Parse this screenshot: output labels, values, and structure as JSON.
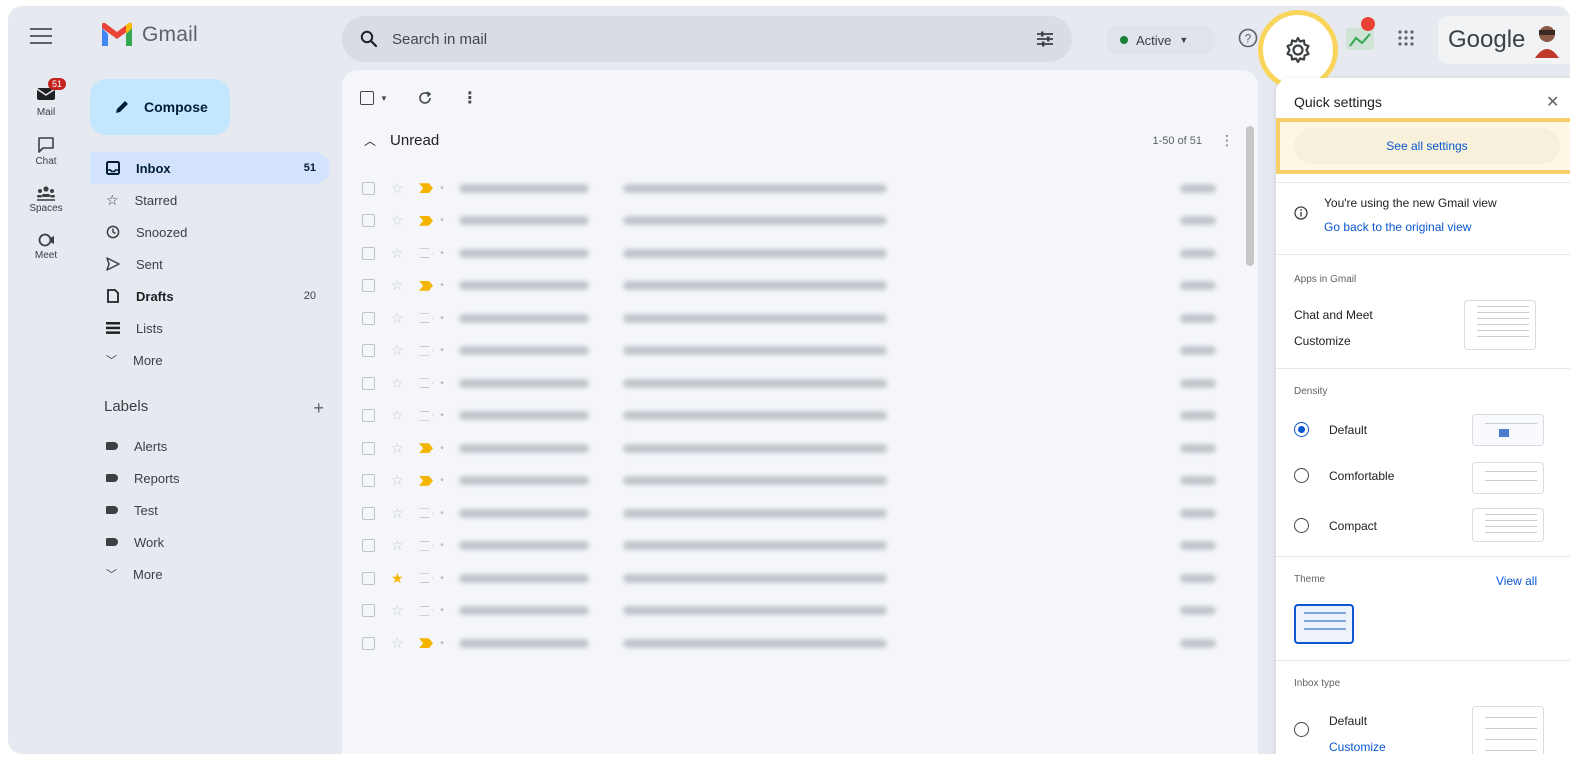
{
  "app": {
    "brand": "Gmail",
    "account_brand": "Google"
  },
  "search": {
    "placeholder": "Search in mail"
  },
  "status": {
    "label": "Active"
  },
  "rail": {
    "mail": {
      "label": "Mail",
      "badge": "51"
    },
    "chat": {
      "label": "Chat"
    },
    "spaces": {
      "label": "Spaces"
    },
    "meet": {
      "label": "Meet"
    }
  },
  "compose": {
    "label": "Compose"
  },
  "nav": {
    "inbox": {
      "label": "Inbox",
      "count": "51"
    },
    "starred": {
      "label": "Starred"
    },
    "snoozed": {
      "label": "Snoozed"
    },
    "sent": {
      "label": "Sent"
    },
    "drafts": {
      "label": "Drafts",
      "count": "20"
    },
    "lists": {
      "label": "Lists"
    },
    "more": {
      "label": "More"
    }
  },
  "labels": {
    "heading": "Labels",
    "items": [
      {
        "label": "Alerts"
      },
      {
        "label": "Reports"
      },
      {
        "label": "Test"
      },
      {
        "label": "Work"
      }
    ],
    "more": "More"
  },
  "mail_list": {
    "section": "Unread",
    "range": "1-50 of 51",
    "rows": [
      {
        "starred": false,
        "important": true
      },
      {
        "starred": false,
        "important": true
      },
      {
        "starred": false,
        "important": false
      },
      {
        "starred": false,
        "important": true
      },
      {
        "starred": false,
        "important": false
      },
      {
        "starred": false,
        "important": false
      },
      {
        "starred": false,
        "important": false
      },
      {
        "starred": false,
        "important": false
      },
      {
        "starred": false,
        "important": true
      },
      {
        "starred": false,
        "important": true
      },
      {
        "starred": false,
        "important": false
      },
      {
        "starred": false,
        "important": false
      },
      {
        "starred": true,
        "important": false
      },
      {
        "starred": false,
        "important": false
      },
      {
        "starred": false,
        "important": true
      }
    ]
  },
  "quick_settings": {
    "title": "Quick settings",
    "see_all": "See all settings",
    "info_text": "You're using the new Gmail view",
    "info_link": "Go back to the original view",
    "apps_label": "Apps in Gmail",
    "chat_meet": "Chat and Meet",
    "customize": "Customize",
    "density_label": "Density",
    "density_options": [
      "Default",
      "Comfortable",
      "Compact"
    ],
    "density_selected": "Default",
    "theme_label": "Theme",
    "view_all": "View all",
    "inbox_type_label": "Inbox type",
    "inbox_default": "Default",
    "inbox_customize": "Customize"
  },
  "colors": {
    "accent": "#0b57d0",
    "highlight": "#f6cf6b",
    "compose_bg": "#c2e7ff",
    "active_dot": "#188038"
  }
}
